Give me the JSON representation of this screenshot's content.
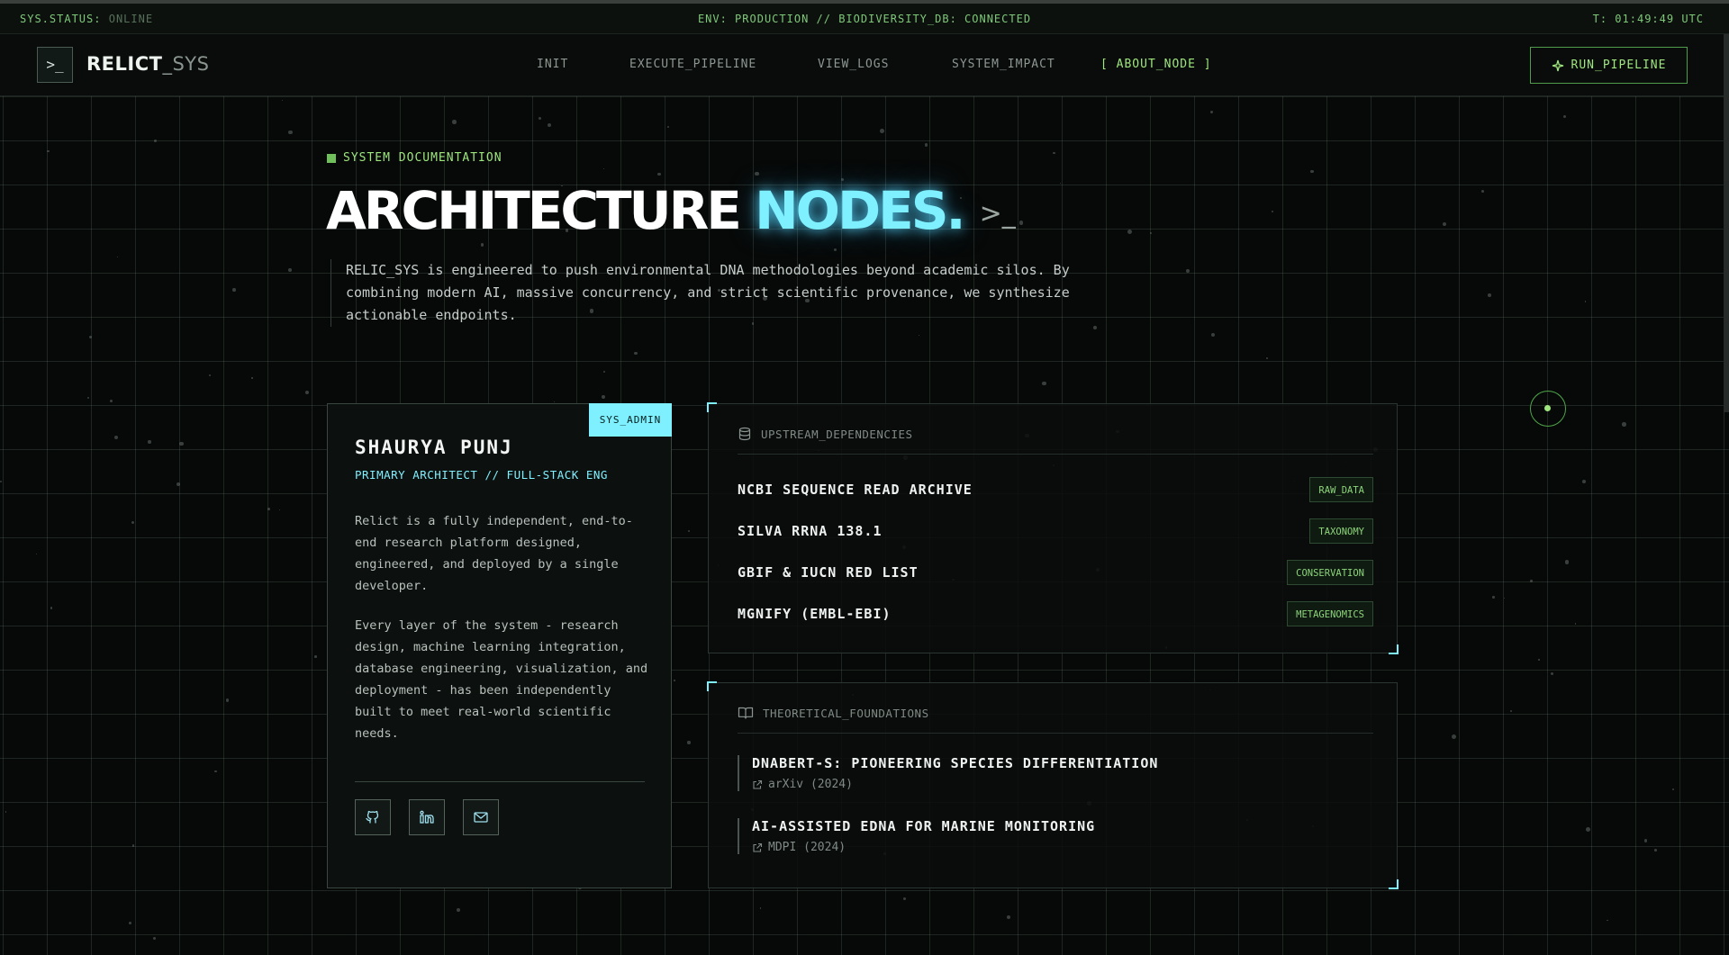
{
  "status_bar": {
    "status_label": "SYS.STATUS:",
    "status_value": "ONLINE",
    "environment": "ENV: PRODUCTION // BIODIVERSITY_DB: CONNECTED",
    "clock": "T: 01:49:49 UTC"
  },
  "nav": {
    "logo_symbol": ">_",
    "logo_main": "RELICT",
    "logo_suffix": "_SYS",
    "links": [
      "INIT",
      "EXECUTE_PIPELINE",
      "VIEW_LOGS",
      "SYSTEM_IMPACT",
      "[ ABOUT_NODE ]"
    ],
    "active_link": "[ ABOUT_NODE ]",
    "run_button": "RUN_PIPELINE",
    "run_icon": "sparkle-icon"
  },
  "hero": {
    "eyebrow": "SYSTEM DOCUMENTATION",
    "title_main": "ARCHITECTURE",
    "title_accent": "NODES.",
    "title_prompt": ">_",
    "description": "RELIC_SYS is engineered to push environmental DNA methodologies beyond academic silos. By combining modern AI, massive concurrency, and strict scientific provenance, we synthesize actionable endpoints."
  },
  "profile": {
    "badge": "SYS_ADMIN",
    "name": "SHAURYA PUNJ",
    "role": "PRIMARY ARCHITECT // FULL-STACK ENG",
    "bio_1": "Relict is a fully independent, end-to-end research platform designed, engineered, and deployed by a single developer.",
    "bio_2": "Every layer of the system - research design, machine learning integration, database engineering, visualization, and deployment - has been independently built to meet real-world scientific needs.",
    "icons": [
      "github-icon",
      "linkedin-icon",
      "mail-icon"
    ]
  },
  "dependencies": {
    "heading": "UPSTREAM_DEPENDENCIES",
    "heading_icon": "database-icon",
    "items": [
      {
        "name": "NCBI SEQUENCE READ ARCHIVE",
        "tag": "RAW_DATA"
      },
      {
        "name": "SILVA RRNA 138.1",
        "tag": "TAXONOMY"
      },
      {
        "name": "GBIF & IUCN RED LIST",
        "tag": "CONSERVATION"
      },
      {
        "name": "MGNIFY (EMBL-EBI)",
        "tag": "METAGENOMICS"
      }
    ]
  },
  "foundations": {
    "heading": "THEORETICAL_FOUNDATIONS",
    "heading_icon": "book-icon",
    "papers": [
      {
        "title": "DNABERT-S: PIONEERING SPECIES DIFFERENTIATION",
        "source": "arXiv (2024)"
      },
      {
        "title": "AI-ASSISTED EDNA FOR MARINE MONITORING",
        "source": "MDPI (2024)"
      }
    ]
  },
  "colors": {
    "accent_green": "#9fe67f",
    "accent_cyan": "#7ff0ff",
    "background": "#070908"
  }
}
